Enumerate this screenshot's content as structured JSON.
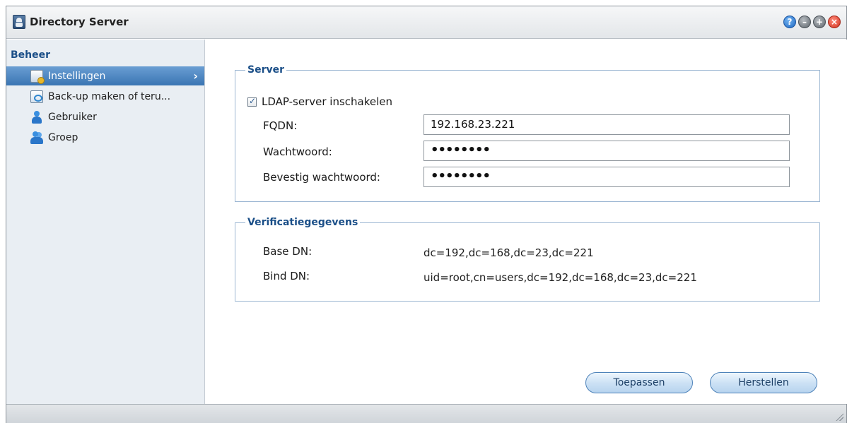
{
  "window": {
    "title": "Directory Server",
    "buttons": {
      "help_symbol": "?",
      "minimize_symbol": "–",
      "maximize_symbol": "+",
      "close_symbol": "×"
    }
  },
  "sidebar": {
    "section_title": "Beheer",
    "items": [
      {
        "label": "Instellingen",
        "icon": "settings-icon",
        "active": true
      },
      {
        "label": "Back-up maken of teru...",
        "icon": "backup-icon",
        "active": false
      },
      {
        "label": "Gebruiker",
        "icon": "user-icon",
        "active": false
      },
      {
        "label": "Groep",
        "icon": "group-icon",
        "active": false
      }
    ],
    "active_chevron": "›"
  },
  "server": {
    "legend": "Server",
    "enable_label": "LDAP-server inschakelen",
    "enable_checked": true,
    "fqdn_label": "FQDN:",
    "fqdn_value": "192.168.23.221",
    "password_label": "Wachtwoord:",
    "password_value": "••••••••",
    "confirm_label": "Bevestig wachtwoord:",
    "confirm_value": "••••••••"
  },
  "verification": {
    "legend": "Verificatiegegevens",
    "base_dn_label": "Base DN:",
    "base_dn_value": "dc=192,dc=168,dc=23,dc=221",
    "bind_dn_label": "Bind DN:",
    "bind_dn_value": "uid=root,cn=users,dc=192,dc=168,dc=23,dc=221"
  },
  "actions": {
    "apply_label": "Toepassen",
    "reset_label": "Herstellen"
  },
  "colors": {
    "accent": "#1b4f88",
    "active_item": "#3a75b3",
    "sidebar_bg": "#e9eef3"
  }
}
